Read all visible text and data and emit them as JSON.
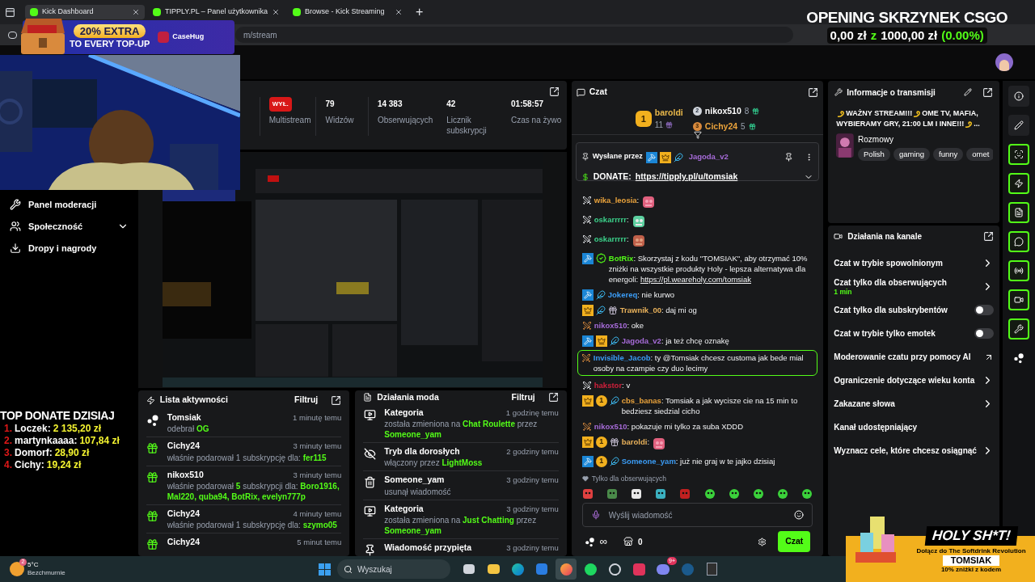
{
  "browser": {
    "tabs": [
      {
        "title": "Kick Dashboard",
        "selected": true
      },
      {
        "title": "TIPPLY.PL – Panel użytkownika",
        "selected": false
      },
      {
        "title": "Browse - Kick Streaming",
        "selected": false
      }
    ],
    "new_tab": "+",
    "url": "m/stream"
  },
  "overlays": {
    "promo": {
      "headline": "20% EXTRA",
      "subline": "TO EVERY TOP-UP",
      "brand": "CaseHug"
    },
    "case_counter": {
      "title": "OPENING SKRZYNEK CSGO",
      "spent": "0,00 zł",
      "separator": "z",
      "budget": "1000,00 zł",
      "percent": "(0.00%)"
    },
    "top_donate": {
      "title": "TOP DONATE DZISIAJ",
      "entries": [
        {
          "rank": "1.",
          "name": "Loczek:",
          "amount": "2 135,20 zł"
        },
        {
          "rank": "2.",
          "name": "martynkaaaa:",
          "amount": "107,84 zł"
        },
        {
          "rank": "3.",
          "name": "Domorf:",
          "amount": "28,90 zł"
        },
        {
          "rank": "4.",
          "name": "Cichy:",
          "amount": "19,24 zł"
        }
      ]
    },
    "holy_ad": {
      "headline": "HOLY SH*T!",
      "tagline": "Dołącz do The Softdrink Revolution",
      "code": "TOMSIAK",
      "note": "10% zniżki z kodem"
    }
  },
  "sidebar": {
    "items": [
      {
        "label": "Panel moderacji",
        "kind": "wrench"
      },
      {
        "label": "Społeczność",
        "kind": "users",
        "expanded": false
      },
      {
        "label": "Dropy i nagrody",
        "kind": "drops"
      }
    ]
  },
  "stats": [
    {
      "value": "WYŁ.",
      "label": "Multistream",
      "kind": "badge"
    },
    {
      "value": "79",
      "label": "Widzów",
      "kind": "number"
    },
    {
      "value": "14 383",
      "label": "Obserwujących",
      "kind": "number"
    },
    {
      "value": "42",
      "label": "Licznik subskrypcji",
      "kind": "number"
    },
    {
      "value": "01:58:57",
      "label": "Czas na żywo",
      "kind": "number"
    }
  ],
  "activity": {
    "title": "Lista aktywności",
    "filter": "Filtruj",
    "items": [
      {
        "kind": "og",
        "name": "Tomsiak",
        "time": "1 minutę temu",
        "parts": [
          {
            "text": "odebrał ",
            "highlight": false
          },
          {
            "text": "OG",
            "highlight": true
          }
        ]
      },
      {
        "kind": "gift",
        "name": "Cichy24",
        "time": "3 minuty temu",
        "parts": [
          {
            "text": "właśnie podarował 1 subskrypcję dla: ",
            "highlight": false
          },
          {
            "text": "fer115",
            "highlight": true
          }
        ]
      },
      {
        "kind": "gift",
        "name": "nikox510",
        "time": "3 minuty temu",
        "parts": [
          {
            "text": "właśnie podarował ",
            "highlight": false
          },
          {
            "text": "5",
            "highlight": true
          },
          {
            "text": " subskrypcji dla: ",
            "highlight": false
          },
          {
            "text": "Boro1916, Mal220, quba94, BotRix, evelyn777p",
            "highlight": true
          }
        ]
      },
      {
        "kind": "gift",
        "name": "Cichy24",
        "time": "4 minuty temu",
        "parts": [
          {
            "text": "właśnie podarował 1 subskrypcję dla: ",
            "highlight": false
          },
          {
            "text": "szymo05",
            "highlight": true
          }
        ]
      },
      {
        "kind": "gift",
        "name": "Cichy24",
        "time": "5 minut temu"
      }
    ]
  },
  "mod_actions": {
    "title": "Działania moda",
    "filter": "Filtruj",
    "items": [
      {
        "kind": "category",
        "title": "Kategoria",
        "time": "1 godzinę temu",
        "parts": [
          {
            "text": "została zmieniona na ",
            "highlight": false
          },
          {
            "text": "Chat Roulette",
            "highlight": true
          },
          {
            "text": " przez ",
            "highlight": false
          },
          {
            "text": "Someone_yam",
            "highlight": true
          }
        ]
      },
      {
        "kind": "adult",
        "title": "Tryb dla dorosłych",
        "time": "2 godziny temu",
        "parts": [
          {
            "text": "włączony przez ",
            "highlight": false
          },
          {
            "text": "LightMoss",
            "highlight": true
          }
        ]
      },
      {
        "kind": "delete",
        "title": "Someone_yam",
        "time": "3 godziny temu",
        "parts": [
          {
            "text": "usunął wiadomość",
            "highlight": false
          }
        ]
      },
      {
        "kind": "category",
        "title": "Kategoria",
        "time": "3 godziny temu",
        "parts": [
          {
            "text": "została zmieniona na ",
            "highlight": false
          },
          {
            "text": "Just Chatting",
            "highlight": true
          },
          {
            "text": " przez ",
            "highlight": false
          },
          {
            "text": "Someone_yam",
            "highlight": true
          }
        ]
      },
      {
        "kind": "pin",
        "title": "Wiadomość przypięta",
        "time": "3 godziny temu"
      }
    ]
  },
  "chat": {
    "title": "Czat",
    "gifters": [
      {
        "rank": "1",
        "name": "baroldi",
        "count": "11",
        "color": "#e9b84a"
      },
      {
        "rank": "2",
        "name": "nikox510",
        "count": "8",
        "color": "#ffffff"
      },
      {
        "rank": "3",
        "name": "Cichy24",
        "count": "5",
        "color": "#e9a23b"
      }
    ],
    "pinned": {
      "label": "Wysłane przez",
      "author": "Jagoda_v2",
      "badges": [
        {
          "kind": "moderator"
        },
        {
          "kind": "vip"
        },
        {
          "kind": "wings"
        }
      ],
      "text": "DONATE: ",
      "link": "https://tipply.pl/u/tomsiak"
    },
    "messages": [
      {
        "kind": "emote",
        "name": "wika_leosia",
        "color": "#e9a23b",
        "highlighted": false,
        "badges": [
          {
            "kind": "sword"
          }
        ],
        "text": ":"
      },
      {
        "kind": "emote",
        "name": "oskarrrrr",
        "color": "#3bd18a",
        "highlighted": false,
        "badges": [
          {
            "kind": "sword"
          }
        ],
        "text": ":"
      },
      {
        "kind": "emote",
        "name": "oskarrrrr",
        "color": "#3bd18a",
        "highlighted": false,
        "badges": [
          {
            "kind": "sword"
          }
        ],
        "text": ":"
      },
      {
        "kind": "text",
        "name": "BotRix",
        "color": "#53fc18",
        "highlighted": false,
        "badges": [
          {
            "kind": "moderator"
          },
          {
            "kind": "verified"
          }
        ],
        "text": ": Skorzystaj z kodu \"TOMSIAK\", aby otrzymać 10% zniżki na wszystkie produkty Holy - lepsza alternatywa dla energoli: ",
        "link": "https://pl.weareholy.com/tomsiak"
      },
      {
        "kind": "text",
        "name": "Jokereq",
        "color": "#3b9cf5",
        "highlighted": false,
        "badges": [
          {
            "kind": "moderator"
          },
          {
            "kind": "wings"
          }
        ],
        "text": ": nie kurwo"
      },
      {
        "kind": "text",
        "name": "Trawnik_00",
        "color": "#e9b25b",
        "highlighted": false,
        "badges": [
          {
            "kind": "vip"
          },
          {
            "kind": "wings"
          },
          {
            "kind": "gift"
          }
        ],
        "text": ": daj mi og"
      },
      {
        "kind": "text",
        "name": "nikox510",
        "color": "#a66bd8",
        "highlighted": false,
        "badges": [
          {
            "kind": "sword-gold"
          }
        ],
        "text": ": oke"
      },
      {
        "kind": "text",
        "name": "Jagoda_v2",
        "color": "#a66bd8",
        "highlighted": false,
        "badges": [
          {
            "kind": "moderator"
          },
          {
            "kind": "vip"
          },
          {
            "kind": "wings"
          }
        ],
        "text": ": ja też chcę oznakę"
      },
      {
        "kind": "text",
        "name": "Invisible_Jacob",
        "color": "#3b9cf5",
        "highlighted": true,
        "badges": [
          {
            "kind": "sword-gold"
          }
        ],
        "text": ": ty @Tomsiak chcesz customa jak bede mial osoby na czampie czy duo lecimy"
      },
      {
        "kind": "text",
        "name": "hakstor",
        "color": "#d0203b",
        "highlighted": false,
        "badges": [
          {
            "kind": "sword"
          }
        ],
        "text": ": v"
      },
      {
        "kind": "text",
        "name": "cbs_banas",
        "color": "#e9a23b",
        "highlighted": false,
        "badges": [
          {
            "kind": "vip"
          },
          {
            "kind": "rank",
            "label": "1"
          },
          {
            "kind": "wings"
          }
        ],
        "text": ": Tomsiak a jak wycisze cie na 15 min to bedziesz siedzial cicho"
      },
      {
        "kind": "text",
        "name": "nikox510",
        "color": "#a66bd8",
        "highlighted": false,
        "badges": [
          {
            "kind": "sword-gold"
          }
        ],
        "text": ": pokazuje mi tylko za suba XDDD"
      },
      {
        "kind": "emote",
        "name": "baroldi",
        "color": "#e9b25b",
        "highlighted": false,
        "badges": [
          {
            "kind": "vip"
          },
          {
            "kind": "rank",
            "label": "1"
          },
          {
            "kind": "gift"
          }
        ],
        "text": ":"
      },
      {
        "kind": "text",
        "name": "Someone_yam",
        "color": "#3b9cf5",
        "highlighted": false,
        "badges": [
          {
            "kind": "moderator"
          },
          {
            "kind": "rank",
            "label": "1"
          },
          {
            "kind": "wings"
          }
        ],
        "text": ": już nie graj w te jajko dzisiaj"
      }
    ],
    "mode": "Tylko dla obserwujących",
    "placeholder": "Wyślij wiadomość",
    "points": "∞",
    "store_count": "0",
    "send": "Czat"
  },
  "info": {
    "title": "Informacje o transmisji",
    "title_segments": [
      {
        "text": "WAŻNY STREAM!!!",
        "swirl": true
      },
      {
        "text": "OME TV, MAFIA,",
        "swirl": true
      },
      {
        "text": "WYBIERAMY GRY, 21:00 LM I INNE!!!"
      },
      {
        "text": "...",
        "swirl": true
      }
    ],
    "category": "Rozmowy",
    "tags": [
      "Polish",
      "gaming",
      "funny",
      "omet"
    ]
  },
  "channel": {
    "title": "Działania na kanale",
    "items": [
      {
        "kind": "link",
        "label": "Czat w trybie spowolnionym"
      },
      {
        "kind": "link",
        "label": "Czat tylko dla obserwujących",
        "detail": "1 min"
      },
      {
        "kind": "toggle",
        "label": "Czat tylko dla subskrybentów",
        "on": false
      },
      {
        "kind": "toggle",
        "label": "Czat w trybie tylko emotek",
        "on": false
      },
      {
        "kind": "external",
        "label": "Moderowanie czatu przy pomocy AI"
      },
      {
        "kind": "link",
        "label": "Ograniczenie dotyczące wieku konta"
      },
      {
        "kind": "link",
        "label": "Zakazane słowa"
      },
      {
        "kind": "plain",
        "label": "Kanał udostępniający"
      },
      {
        "kind": "link",
        "label": "Wyznacz cele, które chcesz osiągnąć"
      }
    ]
  },
  "rail": [
    {
      "kind": "info",
      "selected": false
    },
    {
      "kind": "edit",
      "selected": false
    },
    {
      "kind": "camera",
      "selected": true
    },
    {
      "kind": "activity",
      "selected": true
    },
    {
      "kind": "notes",
      "selected": true
    },
    {
      "kind": "chat",
      "selected": true
    },
    {
      "kind": "broadcast",
      "selected": true
    },
    {
      "kind": "channel",
      "selected": true
    },
    {
      "kind": "tools",
      "selected": true
    },
    {
      "kind": "more",
      "selected": false
    }
  ],
  "taskbar": {
    "weather": {
      "temp": "5°C",
      "condition": "Bezchmurnie",
      "badge": "2"
    },
    "search": "Wyszukaj",
    "apps": [
      {
        "kind": "taskview",
        "selected": false
      },
      {
        "kind": "files",
        "selected": false
      },
      {
        "kind": "edge",
        "selected": false
      },
      {
        "kind": "store",
        "selected": false
      },
      {
        "kind": "firefox",
        "selected": true
      },
      {
        "kind": "spotify",
        "selected": false
      },
      {
        "kind": "obs",
        "selected": false
      },
      {
        "kind": "tiktok",
        "selected": false
      },
      {
        "kind": "discord",
        "selected": false,
        "badge": "9+"
      },
      {
        "kind": "steam",
        "selected": false
      },
      {
        "kind": "epic",
        "selected": false
      }
    ]
  }
}
